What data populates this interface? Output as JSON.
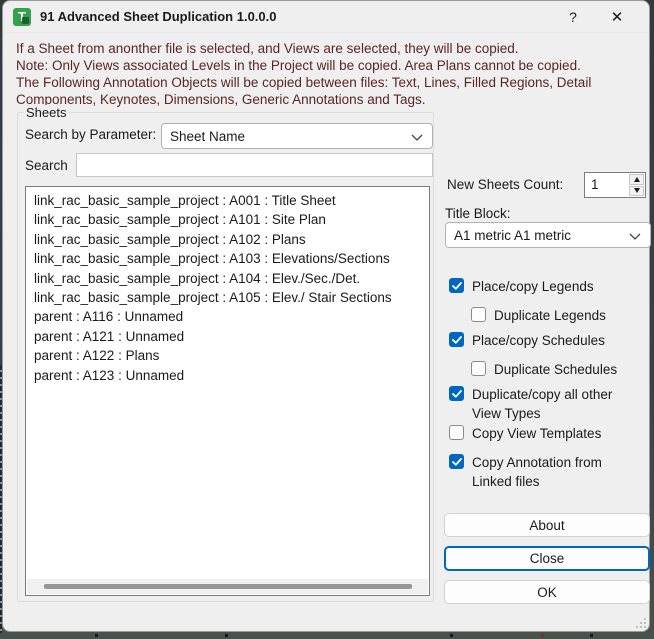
{
  "window": {
    "title": "91 Advanced Sheet Duplication 1.0.0.0",
    "app_icon_letter": "T",
    "help_glyph": "?",
    "close_glyph": "✕"
  },
  "intro_lines": [
    "If a Sheet from anonther file is selected, and Views are selected, they will be copied.",
    "Note: Only Views associated Levels in the Project will be copied. Area Plans cannot be copied.",
    "The Following Annotation Objects will be copied between files: Text, Lines, Filled Regions, Detail",
    "Components, Keynotes, Dimensions, Generic Annotations and Tags."
  ],
  "sheets_group": {
    "label": "Sheets",
    "search_by_parameter_label": "Search by Parameter:",
    "parameter_value": "Sheet Name",
    "search_label": "Search",
    "search_value": "",
    "items": [
      "link_rac_basic_sample_project : A001 : Title Sheet",
      "link_rac_basic_sample_project : A101 : Site Plan",
      "link_rac_basic_sample_project : A102 : Plans",
      "link_rac_basic_sample_project : A103 : Elevations/Sections",
      "link_rac_basic_sample_project : A104 : Elev./Sec./Det.",
      "link_rac_basic_sample_project : A105 : Elev./ Stair Sections",
      "parent : A116 : Unnamed",
      "parent : A121 : Unnamed",
      "parent : A122 : Plans",
      "parent : A123 : Unnamed"
    ]
  },
  "right_panel": {
    "new_sheets_count_label": "New Sheets Count:",
    "new_sheets_count_value": "1",
    "title_block_label": "Title Block:",
    "title_block_value": "A1 metric A1 metric",
    "checkboxes": [
      {
        "id": "place-copy-legends",
        "label": "Place/copy Legends",
        "checked": true,
        "indent": false
      },
      {
        "id": "duplicate-legends",
        "label": "Duplicate Legends",
        "checked": false,
        "indent": true
      },
      {
        "id": "place-copy-schedules",
        "label": "Place/copy Schedules",
        "checked": true,
        "indent": false
      },
      {
        "id": "duplicate-schedules",
        "label": "Duplicate Schedules",
        "checked": false,
        "indent": true
      },
      {
        "id": "duplicate-copy-all-other-view-types",
        "label": "Duplicate/copy all other\nView Types",
        "checked": true,
        "indent": false
      },
      {
        "id": "copy-view-templates",
        "label": "Copy View Templates",
        "checked": false,
        "indent": false
      },
      {
        "id": "copy-annotation-from-linked-files",
        "label": "Copy Annotation from\nLinked files",
        "checked": true,
        "indent": false
      }
    ],
    "buttons": [
      {
        "id": "about",
        "label": "About",
        "default": false
      },
      {
        "id": "close",
        "label": "Close",
        "default": true
      },
      {
        "id": "ok",
        "label": "OK",
        "default": false
      }
    ]
  },
  "colors": {
    "accent_blue": "#0067C0",
    "app_icon_green": "#36A14C",
    "warning_text": "#5A2524",
    "taskbar_dark": "#3A4146"
  }
}
